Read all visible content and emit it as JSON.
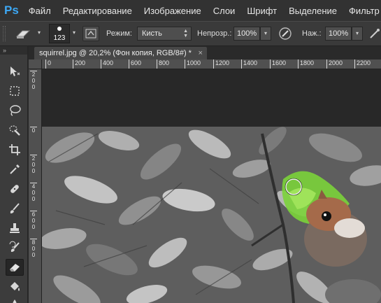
{
  "app": {
    "logo": "Ps"
  },
  "menu": [
    "Файл",
    "Редактирование",
    "Изображение",
    "Слои",
    "Шрифт",
    "Выделение",
    "Фильтр"
  ],
  "options": {
    "brush_size": "123",
    "mode_label": "Режим:",
    "mode_value": "Кисть",
    "opacity_label": "Непрозр.:",
    "opacity_value": "100%",
    "flow_label": "Наж.:",
    "flow_value": "100%"
  },
  "tab": {
    "title": "squirrel.jpg @ 20,2% (Фон копия, RGB/8#) *",
    "close": "×"
  },
  "ruler": {
    "h": [
      "0",
      "200",
      "400",
      "600",
      "800",
      "1000",
      "1200",
      "1400",
      "1600",
      "1800",
      "2000",
      "2200"
    ],
    "v": [
      "2\n0\n0",
      "0",
      "2\n0\n0",
      "4\n0\n0",
      "6\n0\n0",
      "8\n0\n0"
    ]
  },
  "tools": [
    "move-tool-icon",
    "marquee-tool-icon",
    "lasso-tool-icon",
    "quick-select-tool-icon",
    "crop-tool-icon",
    "eyedropper-tool-icon",
    "healing-brush-tool-icon",
    "brush-tool-icon",
    "clone-stamp-tool-icon",
    "history-brush-tool-icon",
    "eraser-tool-icon",
    "paint-bucket-tool-icon",
    "blur-tool-icon"
  ],
  "colors": {
    "menubar": "#323232",
    "optbar": "#3a3a3a",
    "toolbar": "#3c3c3c",
    "accent": "#3da8f4",
    "highlight_green": "#7bd33a"
  }
}
